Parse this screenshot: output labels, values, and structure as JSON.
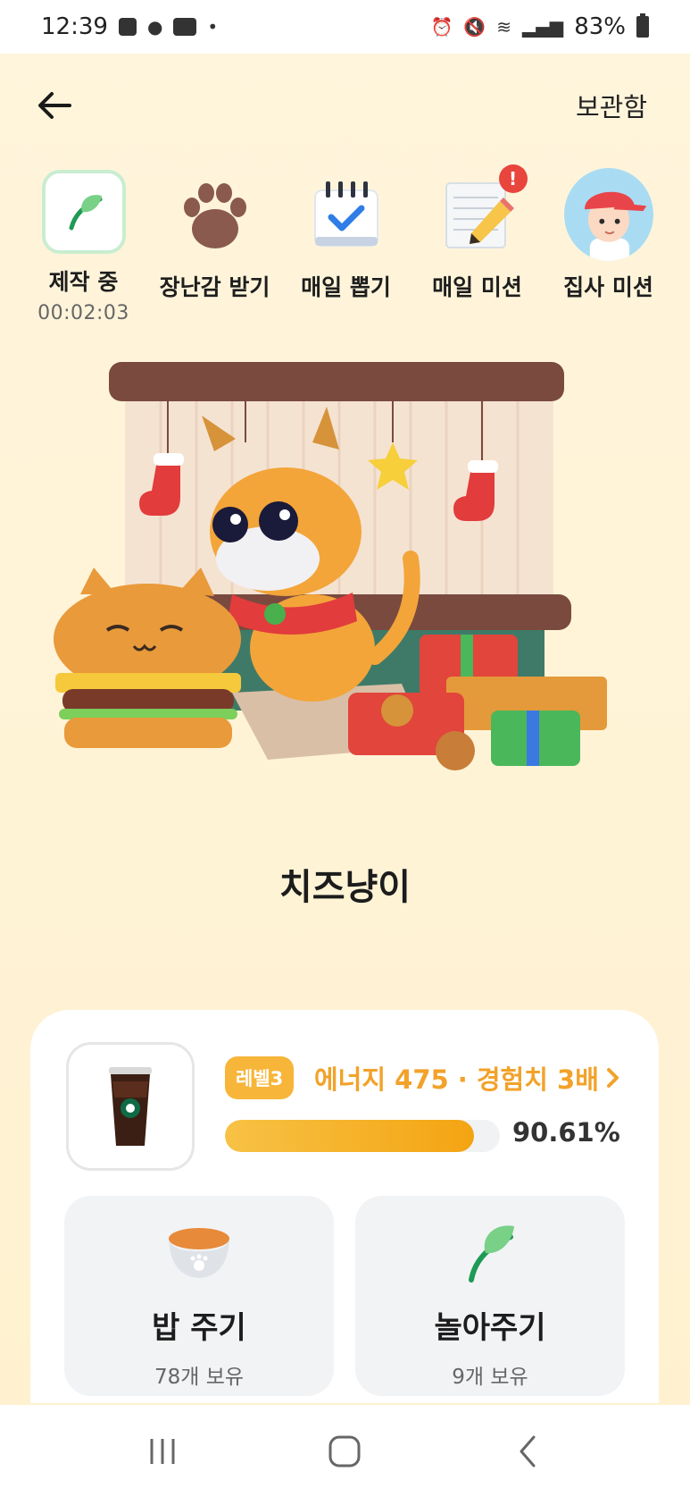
{
  "status_bar": {
    "time": "12:39",
    "battery": "83%",
    "notif_dot": "•"
  },
  "header": {
    "storage_label": "보관함"
  },
  "menu": {
    "items": [
      {
        "label": "제작 중",
        "sub": "00:02:03"
      },
      {
        "label": "장난감 받기"
      },
      {
        "label": "매일 뽑기"
      },
      {
        "label": "매일 미션",
        "badge": "!"
      },
      {
        "label": "집사 미션"
      }
    ]
  },
  "pet": {
    "name": "치즈냥이"
  },
  "status_card": {
    "level": "레벨3",
    "energy_text": "에너지 475 · 경험치 3배",
    "progress_fraction": 0.9061,
    "progress_text": "90.61%"
  },
  "actions": {
    "feed": {
      "title": "밥 주기",
      "count": "78개 보유"
    },
    "play": {
      "title": "놀아주기",
      "count": "9개 보유"
    }
  },
  "colors": {
    "accent": "#f2a22a",
    "badge": "#f7b539",
    "progress": "#f4a412",
    "alert": "#e8453c"
  },
  "icons": [
    "back-arrow-icon",
    "leaf-icon",
    "paw-icon",
    "calendar-check-icon",
    "notepad-pencil-icon",
    "boy-avatar-icon",
    "coffee-cup-icon",
    "food-bowl-icon",
    "chevron-right-icon"
  ]
}
